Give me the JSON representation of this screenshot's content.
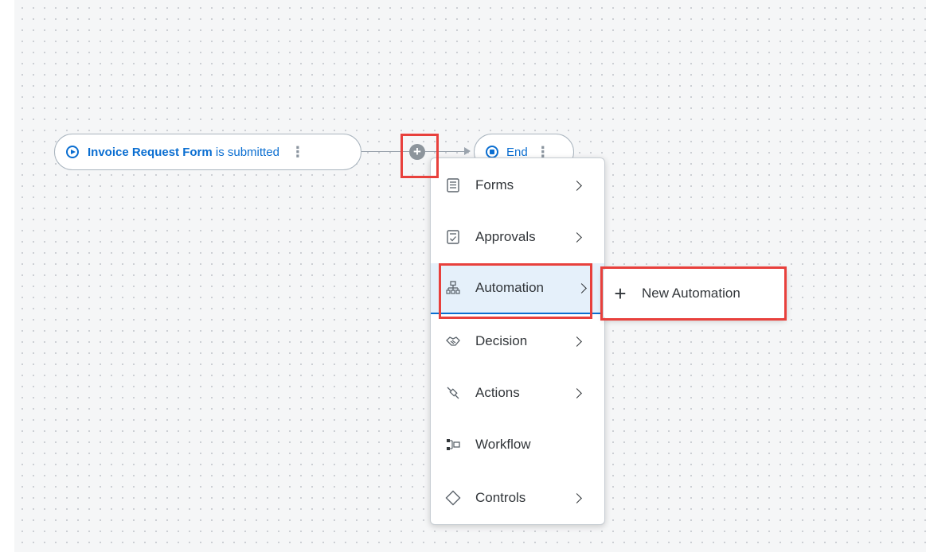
{
  "canvas": {
    "trigger": {
      "form_name": "Invoice Request Form",
      "suffix": "is submitted",
      "more": "⋮"
    },
    "add_step_symbol": "+",
    "end": {
      "label": "End",
      "more": "⋮"
    }
  },
  "menu": {
    "items": [
      {
        "label": "Forms",
        "icon": "form-icon",
        "has_submenu": true
      },
      {
        "label": "Approvals",
        "icon": "approval-icon",
        "has_submenu": true
      },
      {
        "label": "Automation",
        "icon": "automation-icon",
        "has_submenu": true,
        "active": true
      },
      {
        "label": "Decision",
        "icon": "decision-icon",
        "has_submenu": true
      },
      {
        "label": "Actions",
        "icon": "actions-icon",
        "has_submenu": true
      },
      {
        "label": "Workflow",
        "icon": "workflow-icon",
        "has_submenu": false
      },
      {
        "label": "Controls",
        "icon": "controls-icon",
        "has_submenu": true
      }
    ]
  },
  "submenu": {
    "new_automation_label": "New Automation"
  },
  "colors": {
    "accent": "#0a6ed1",
    "highlight": "#e8403c",
    "active_item_bg": "#e5f0fa"
  }
}
